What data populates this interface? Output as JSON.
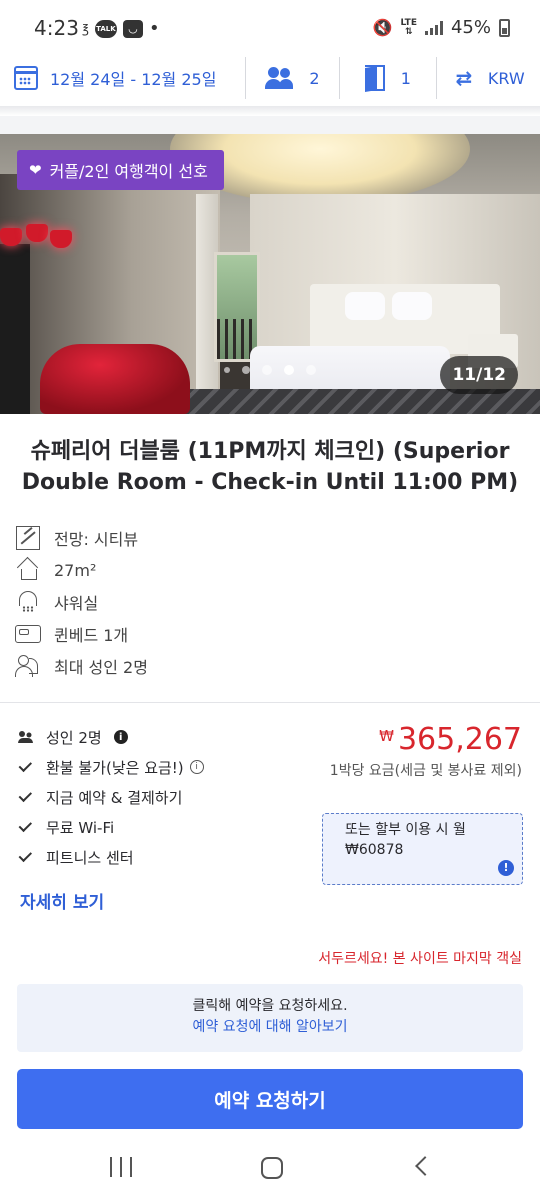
{
  "status_bar": {
    "time": "4:23",
    "talk_label": "TALK",
    "network": "LTE",
    "battery": "45%"
  },
  "search_bar": {
    "dates": "12월 24일 - 12월 25일",
    "guests": "2",
    "rooms": "1",
    "currency": "KRW"
  },
  "gallery": {
    "badge": "커플/2인 여행객이 선호",
    "counter": "11/12"
  },
  "room": {
    "title": "슈페리어 더블룸 (11PM까지 체크인) (Superior Double Room - Check-in Until 11:00 PM)",
    "amenities": [
      {
        "icon": "view-icon",
        "label": "전망: 시티뷰"
      },
      {
        "icon": "house-icon",
        "label": "27m²"
      },
      {
        "icon": "shower-icon",
        "label": "샤워실"
      },
      {
        "icon": "bed-icon",
        "label": "퀸베드 1개"
      },
      {
        "icon": "people-icon",
        "label": "최대 성인 2명"
      }
    ]
  },
  "features": {
    "adults": "성인 2명",
    "items": [
      "환불 불가(낮은 요금!)",
      "지금 예약 & 결제하기",
      "무료 Wi-Fi",
      "피트니스 센터"
    ],
    "more_link": "자세히 보기"
  },
  "price": {
    "currency_symbol": "₩",
    "amount": "365,267",
    "note": "1박당 요금(세금 및 봉사료 제외)",
    "installment_line1": "또는 할부 이용 시 월",
    "installment_line2": "₩60878"
  },
  "urgency": "서두르세요! 본 사이트 마지막 객실",
  "request_box": {
    "line1": "클릭해 예약을 요청하세요.",
    "link": "예약 요청에 대해 알아보기"
  },
  "cta_label": "예약 요청하기",
  "colors": {
    "brand_blue": "#3e6ef0",
    "price_red": "#d8262d",
    "badge_purple": "#7a44c2"
  }
}
